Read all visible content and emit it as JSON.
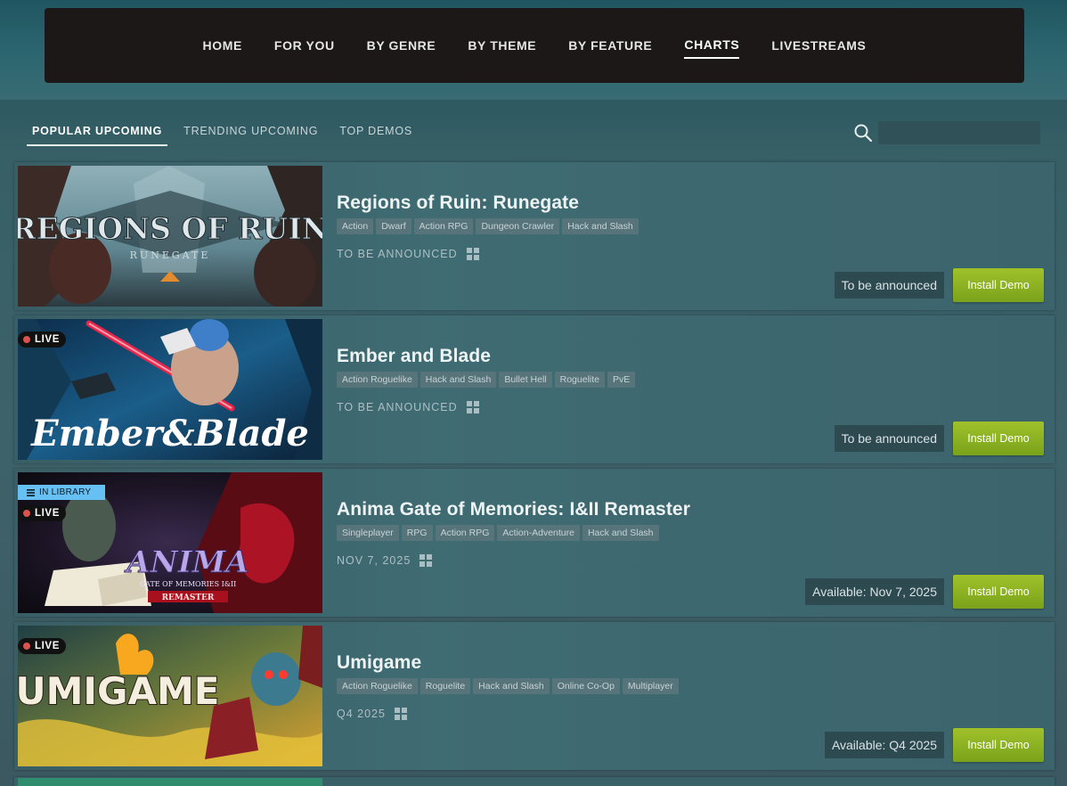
{
  "topnav": {
    "items": [
      "HOME",
      "FOR YOU",
      "BY GENRE",
      "BY THEME",
      "BY FEATURE",
      "CHARTS",
      "LIVESTREAMS"
    ],
    "active_index": 5
  },
  "subtabs": {
    "items": [
      "POPULAR UPCOMING",
      "TRENDING UPCOMING",
      "TOP DEMOS"
    ],
    "active_index": 0
  },
  "search": {
    "placeholder": ""
  },
  "install_label": "Install Demo",
  "badges": {
    "live": "LIVE",
    "in_library": "IN LIBRARY"
  },
  "games": [
    {
      "title": "Regions of Ruin: Runegate",
      "tags": [
        "Action",
        "Dwarf",
        "Action RPG",
        "Dungeon Crawler",
        "Hack and Slash"
      ],
      "release": "TO BE ANNOUNCED",
      "status": "To be announced",
      "live": false,
      "in_library": false,
      "art_text": "REGIONS OF RUIN",
      "art_subtext": "RUNEGATE"
    },
    {
      "title": "Ember and Blade",
      "tags": [
        "Action Roguelike",
        "Hack and Slash",
        "Bullet Hell",
        "Roguelite",
        "PvE"
      ],
      "release": "TO BE ANNOUNCED",
      "status": "To be announced",
      "live": true,
      "in_library": false,
      "art_text": "Ember&Blade"
    },
    {
      "title": "Anima Gate of Memories: I&II Remaster",
      "tags": [
        "Singleplayer",
        "RPG",
        "Action RPG",
        "Action-Adventure",
        "Hack and Slash"
      ],
      "release": "NOV 7, 2025",
      "status": "Available: Nov 7, 2025",
      "live": true,
      "in_library": true,
      "art_text": "ANIMA",
      "art_subtext": "GATE OF MEMORIES I&II",
      "art_subtext2": "REMASTER"
    },
    {
      "title": "Umigame",
      "tags": [
        "Action Roguelike",
        "Roguelite",
        "Hack and Slash",
        "Online Co-Op",
        "Multiplayer"
      ],
      "release": "Q4 2025",
      "status": "Available: Q4 2025",
      "live": true,
      "in_library": false,
      "art_text": "UMIGAME"
    }
  ],
  "colors": {
    "accent_green": "#8db625",
    "nav_bg": "#1b1817",
    "library_blue": "#66c0f4",
    "live_red": "#d9534f"
  },
  "icons": [
    "search-icon",
    "windows-icon",
    "live-dot-icon",
    "library-icon"
  ]
}
